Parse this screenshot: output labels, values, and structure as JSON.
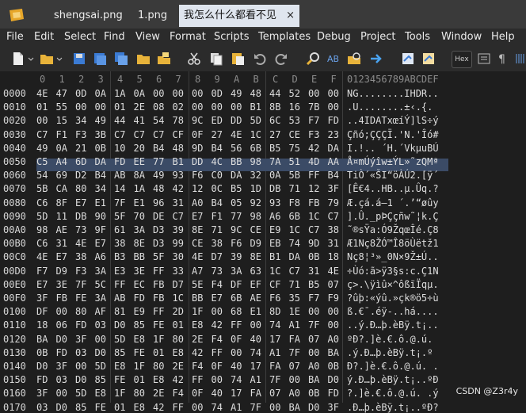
{
  "tabs": [
    {
      "label": "shengsai.png"
    },
    {
      "label": "1.png"
    },
    {
      "label": "我怎么什么都看不见"
    }
  ],
  "tab_close": "×",
  "menu": [
    "File",
    "Edit",
    "Select",
    "Find",
    "View",
    "Format",
    "Scripts",
    "Templates",
    "Debug",
    "Project",
    "Tools",
    "Window",
    "Help"
  ],
  "hex_toggle": "Hex",
  "column_header_hex": [
    "0",
    "1",
    "2",
    "3",
    "4",
    "5",
    "6",
    "7",
    "8",
    "9",
    "A",
    "B",
    "C",
    "D",
    "E",
    "F"
  ],
  "column_header_ascii": "0123456789ABCDEF",
  "rows": [
    {
      "offset": "0000",
      "hex": [
        "4E",
        "47",
        "0D",
        "0A",
        "1A",
        "0A",
        "00",
        "00",
        "00",
        "0D",
        "49",
        "48",
        "44",
        "52",
        "00",
        "00"
      ],
      "ascii": "NG........IHDR.."
    },
    {
      "offset": "0010",
      "hex": [
        "01",
        "55",
        "00",
        "00",
        "01",
        "2E",
        "08",
        "02",
        "00",
        "00",
        "00",
        "B1",
        "8B",
        "16",
        "7B",
        "00"
      ],
      "ascii": ".U........±‹.{."
    },
    {
      "offset": "0020",
      "hex": [
        "00",
        "15",
        "34",
        "49",
        "44",
        "41",
        "54",
        "78",
        "9C",
        "ED",
        "DD",
        "5D",
        "6C",
        "53",
        "F7",
        "FD"
      ],
      "ascii": "..4IDATxœíÝ]lS÷ý"
    },
    {
      "offset": "0030",
      "hex": [
        "C7",
        "F1",
        "F3",
        "3B",
        "C7",
        "C7",
        "C7",
        "CF",
        "0F",
        "27",
        "4E",
        "1C",
        "27",
        "CE",
        "F3",
        "23"
      ],
      "ascii": "Çñó;ÇÇÇÏ.'N.'Îó#"
    },
    {
      "offset": "0040",
      "hex": [
        "49",
        "0A",
        "21",
        "0B",
        "10",
        "20",
        "B4",
        "48",
        "9D",
        "B4",
        "56",
        "6B",
        "B5",
        "75",
        "42",
        "DA"
      ],
      "ascii": "I.!.. ´H.´VkµuBÚ"
    },
    {
      "offset": "0050",
      "hex": [
        "C5",
        "A4",
        "6D",
        "DA",
        "FD",
        "EE",
        "77",
        "B1",
        "DD",
        "4C",
        "BB",
        "98",
        "7A",
        "51",
        "4D",
        "AA"
      ],
      "ascii": "Å¤mÚýîw±ÝL»˜zQMª"
    },
    {
      "offset": "0060",
      "hex": [
        "54",
        "69",
        "D2",
        "B4",
        "AB",
        "8A",
        "49",
        "93",
        "F6",
        "C0",
        "DA",
        "32",
        "0A",
        "5B",
        "FF",
        "B4"
      ],
      "ascii": "TiÒ´«ŠI“öÀÚ2.[ÿ´"
    },
    {
      "offset": "0070",
      "hex": [
        "5B",
        "CA",
        "80",
        "34",
        "14",
        "1A",
        "48",
        "42",
        "12",
        "0C",
        "B5",
        "1D",
        "DB",
        "71",
        "12",
        "3F"
      ],
      "ascii": "[Ê€4..HB..µ.Ûq.?"
    },
    {
      "offset": "0080",
      "hex": [
        "C6",
        "8F",
        "E7",
        "E1",
        "7F",
        "E1",
        "96",
        "31",
        "A0",
        "B4",
        "05",
        "92",
        "93",
        "F8",
        "FB",
        "79"
      ],
      "ascii": "Æ.çá.á–1 ´.’“øûy"
    },
    {
      "offset": "0090",
      "hex": [
        "5D",
        "11",
        "DB",
        "90",
        "5F",
        "70",
        "DE",
        "C7",
        "E7",
        "F1",
        "77",
        "98",
        "A6",
        "6B",
        "1C",
        "C7"
      ],
      "ascii": "].Û._pÞÇçñw˜¦k.Ç"
    },
    {
      "offset": "00A0",
      "hex": [
        "98",
        "AE",
        "73",
        "9F",
        "61",
        "3A",
        "D3",
        "39",
        "8E",
        "71",
        "9C",
        "CE",
        "E9",
        "1C",
        "C7",
        "38"
      ],
      "ascii": "˜®sŸa:Ó9ŽqœÎé.Ç8"
    },
    {
      "offset": "00B0",
      "hex": [
        "C6",
        "31",
        "4E",
        "E7",
        "38",
        "8E",
        "D3",
        "99",
        "CE",
        "38",
        "F6",
        "D9",
        "EB",
        "74",
        "9D",
        "31"
      ],
      "ascii": "Æ1Nç8ŽÓ™Î8öÙëtž1"
    },
    {
      "offset": "00C0",
      "hex": [
        "4E",
        "E7",
        "38",
        "A6",
        "B3",
        "BB",
        "5F",
        "30",
        "4E",
        "D7",
        "39",
        "8E",
        "B1",
        "DA",
        "0B",
        "18"
      ],
      "ascii": "Nç8¦³»_0N×9Ž±Ú.."
    },
    {
      "offset": "00D0",
      "hex": [
        "F7",
        "D9",
        "F3",
        "3A",
        "E3",
        "3E",
        "FF",
        "33",
        "A7",
        "73",
        "3A",
        "63",
        "1C",
        "C7",
        "31",
        "4E"
      ],
      "ascii": "÷Ùó:ã>ÿ3§s:c.Ç1N"
    },
    {
      "offset": "00E0",
      "hex": [
        "E7",
        "3E",
        "7F",
        "5C",
        "FF",
        "EC",
        "FB",
        "D7",
        "5E",
        "F4",
        "DF",
        "EF",
        "CF",
        "71",
        "B5",
        "07"
      ],
      "ascii": "ç>.\\ÿìû×^ôßïÏqµ."
    },
    {
      "offset": "00F0",
      "hex": [
        "3F",
        "FB",
        "FE",
        "3A",
        "AB",
        "FD",
        "FB",
        "1C",
        "BB",
        "E7",
        "6B",
        "AE",
        "F6",
        "35",
        "F7",
        "F9"
      ],
      "ascii": "?ûþ:«ýû.»çk®ö5÷ù"
    },
    {
      "offset": "0100",
      "hex": [
        "DF",
        "00",
        "80",
        "AF",
        "81",
        "E9",
        "FF",
        "2D",
        "1F",
        "00",
        "68",
        "E1",
        "8D",
        "1E",
        "00",
        "00"
      ],
      "ascii": "ß.€¯.éÿ-..há...."
    },
    {
      "offset": "0110",
      "hex": [
        "18",
        "06",
        "FD",
        "03",
        "D0",
        "85",
        "FE",
        "01",
        "E8",
        "42",
        "FF",
        "00",
        "74",
        "A1",
        "7F",
        "00"
      ],
      "ascii": "..ý.Ð…þ.èBÿ.t¡.."
    },
    {
      "offset": "0120",
      "hex": [
        "BA",
        "D0",
        "3F",
        "00",
        "5D",
        "E8",
        "1F",
        "80",
        "2E",
        "F4",
        "0F",
        "40",
        "17",
        "FA",
        "07",
        "A0"
      ],
      "ascii": "ºÐ?.]è.€.ô.@.ú. "
    },
    {
      "offset": "0130",
      "hex": [
        "0B",
        "FD",
        "03",
        "D0",
        "85",
        "FE",
        "01",
        "E8",
        "42",
        "FF",
        "00",
        "74",
        "A1",
        "7F",
        "00",
        "BA"
      ],
      "ascii": ".ý.Ð…þ.èBÿ.t¡.º"
    },
    {
      "offset": "0140",
      "hex": [
        "D0",
        "3F",
        "00",
        "5D",
        "E8",
        "1F",
        "80",
        "2E",
        "F4",
        "0F",
        "40",
        "17",
        "FA",
        "07",
        "A0",
        "0B"
      ],
      "ascii": "Ð?.]è.€.ô.@.ú. ."
    },
    {
      "offset": "0150",
      "hex": [
        "FD",
        "03",
        "D0",
        "85",
        "FE",
        "01",
        "E8",
        "42",
        "FF",
        "00",
        "74",
        "A1",
        "7F",
        "00",
        "BA",
        "D0"
      ],
      "ascii": "ý.Ð…þ.èBÿ.t¡..ºÐ"
    },
    {
      "offset": "0160",
      "hex": [
        "3F",
        "00",
        "5D",
        "E8",
        "1F",
        "80",
        "2E",
        "F4",
        "0F",
        "40",
        "17",
        "FA",
        "07",
        "A0",
        "0B",
        "FD"
      ],
      "ascii": "?.]è.€.ô.@.ú. .ý"
    },
    {
      "offset": "0170",
      "hex": [
        "03",
        "D0",
        "85",
        "FE",
        "01",
        "E8",
        "42",
        "FF",
        "00",
        "74",
        "A1",
        "7F",
        "00",
        "BA",
        "D0",
        "3F"
      ],
      "ascii": ".Ð…þ.èBÿ.t¡..ºÐ?"
    }
  ],
  "watermark": "CSDN @Z3r4y"
}
